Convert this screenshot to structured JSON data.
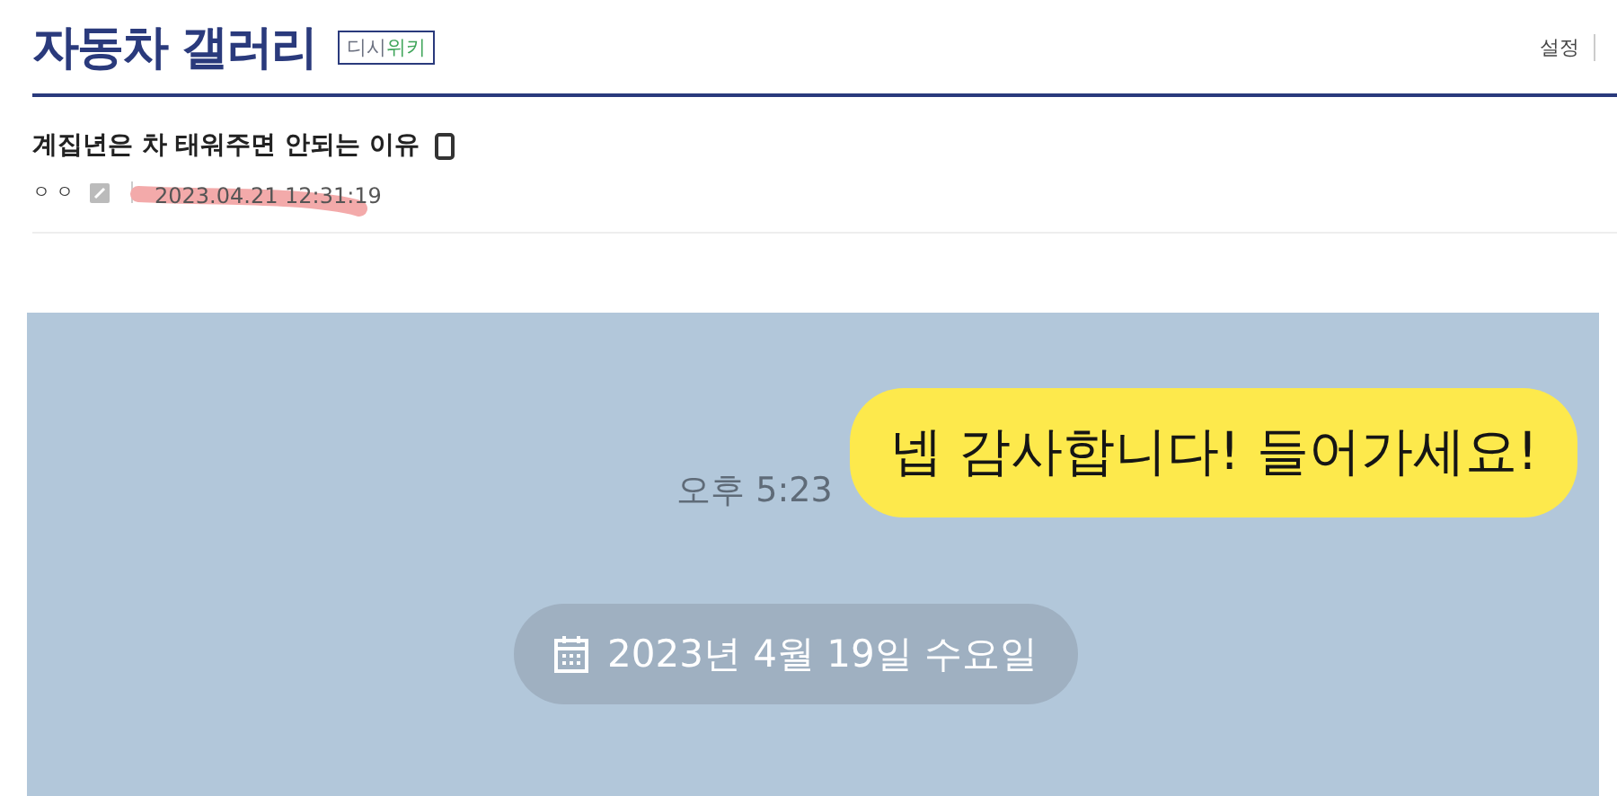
{
  "gallery": {
    "title": "자동차 갤러리",
    "badge": [
      {
        "text": "디시",
        "color": "#6b7080"
      },
      {
        "text": "위키",
        "color": "#3fa55a"
      }
    ],
    "settings": "설정"
  },
  "post": {
    "title": "계집년은 차 태워주면 안되는 이유",
    "mobile": true,
    "author": "ㅇㅇ",
    "date": "2023.04.21  12:31:19",
    "date_scribbled": true
  },
  "chat": {
    "message": "넵 감사합니다! 들어가세요!",
    "time": "오후 5:23",
    "date_divider": "2023년 4월 19일 수요일"
  }
}
